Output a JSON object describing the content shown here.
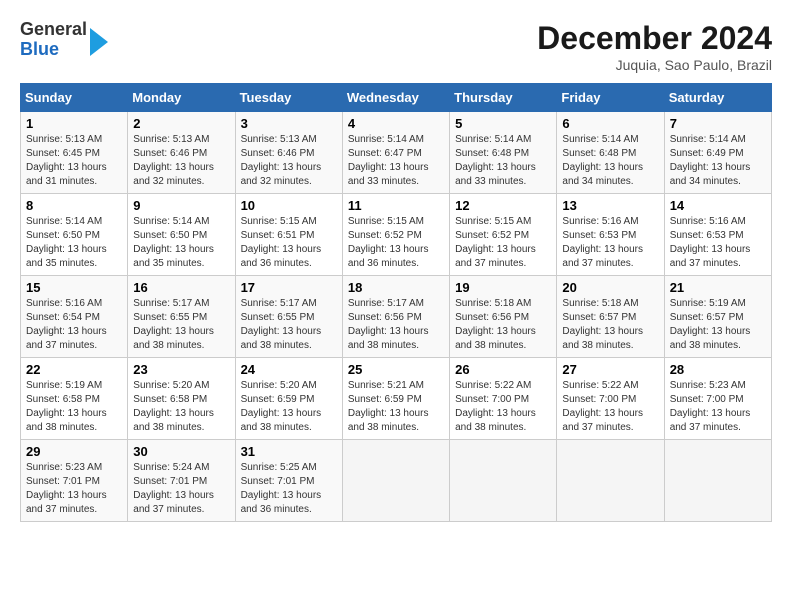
{
  "logo": {
    "general": "General",
    "blue": "Blue"
  },
  "title": "December 2024",
  "subtitle": "Juquia, Sao Paulo, Brazil",
  "weekdays": [
    "Sunday",
    "Monday",
    "Tuesday",
    "Wednesday",
    "Thursday",
    "Friday",
    "Saturday"
  ],
  "weeks": [
    [
      {
        "day": "1",
        "sunrise": "5:13 AM",
        "sunset": "6:45 PM",
        "daylight": "13 hours and 31 minutes."
      },
      {
        "day": "2",
        "sunrise": "5:13 AM",
        "sunset": "6:46 PM",
        "daylight": "13 hours and 32 minutes."
      },
      {
        "day": "3",
        "sunrise": "5:13 AM",
        "sunset": "6:46 PM",
        "daylight": "13 hours and 32 minutes."
      },
      {
        "day": "4",
        "sunrise": "5:14 AM",
        "sunset": "6:47 PM",
        "daylight": "13 hours and 33 minutes."
      },
      {
        "day": "5",
        "sunrise": "5:14 AM",
        "sunset": "6:48 PM",
        "daylight": "13 hours and 33 minutes."
      },
      {
        "day": "6",
        "sunrise": "5:14 AM",
        "sunset": "6:48 PM",
        "daylight": "13 hours and 34 minutes."
      },
      {
        "day": "7",
        "sunrise": "5:14 AM",
        "sunset": "6:49 PM",
        "daylight": "13 hours and 34 minutes."
      }
    ],
    [
      {
        "day": "8",
        "sunrise": "5:14 AM",
        "sunset": "6:50 PM",
        "daylight": "13 hours and 35 minutes."
      },
      {
        "day": "9",
        "sunrise": "5:14 AM",
        "sunset": "6:50 PM",
        "daylight": "13 hours and 35 minutes."
      },
      {
        "day": "10",
        "sunrise": "5:15 AM",
        "sunset": "6:51 PM",
        "daylight": "13 hours and 36 minutes."
      },
      {
        "day": "11",
        "sunrise": "5:15 AM",
        "sunset": "6:52 PM",
        "daylight": "13 hours and 36 minutes."
      },
      {
        "day": "12",
        "sunrise": "5:15 AM",
        "sunset": "6:52 PM",
        "daylight": "13 hours and 37 minutes."
      },
      {
        "day": "13",
        "sunrise": "5:16 AM",
        "sunset": "6:53 PM",
        "daylight": "13 hours and 37 minutes."
      },
      {
        "day": "14",
        "sunrise": "5:16 AM",
        "sunset": "6:53 PM",
        "daylight": "13 hours and 37 minutes."
      }
    ],
    [
      {
        "day": "15",
        "sunrise": "5:16 AM",
        "sunset": "6:54 PM",
        "daylight": "13 hours and 37 minutes."
      },
      {
        "day": "16",
        "sunrise": "5:17 AM",
        "sunset": "6:55 PM",
        "daylight": "13 hours and 38 minutes."
      },
      {
        "day": "17",
        "sunrise": "5:17 AM",
        "sunset": "6:55 PM",
        "daylight": "13 hours and 38 minutes."
      },
      {
        "day": "18",
        "sunrise": "5:17 AM",
        "sunset": "6:56 PM",
        "daylight": "13 hours and 38 minutes."
      },
      {
        "day": "19",
        "sunrise": "5:18 AM",
        "sunset": "6:56 PM",
        "daylight": "13 hours and 38 minutes."
      },
      {
        "day": "20",
        "sunrise": "5:18 AM",
        "sunset": "6:57 PM",
        "daylight": "13 hours and 38 minutes."
      },
      {
        "day": "21",
        "sunrise": "5:19 AM",
        "sunset": "6:57 PM",
        "daylight": "13 hours and 38 minutes."
      }
    ],
    [
      {
        "day": "22",
        "sunrise": "5:19 AM",
        "sunset": "6:58 PM",
        "daylight": "13 hours and 38 minutes."
      },
      {
        "day": "23",
        "sunrise": "5:20 AM",
        "sunset": "6:58 PM",
        "daylight": "13 hours and 38 minutes."
      },
      {
        "day": "24",
        "sunrise": "5:20 AM",
        "sunset": "6:59 PM",
        "daylight": "13 hours and 38 minutes."
      },
      {
        "day": "25",
        "sunrise": "5:21 AM",
        "sunset": "6:59 PM",
        "daylight": "13 hours and 38 minutes."
      },
      {
        "day": "26",
        "sunrise": "5:22 AM",
        "sunset": "7:00 PM",
        "daylight": "13 hours and 38 minutes."
      },
      {
        "day": "27",
        "sunrise": "5:22 AM",
        "sunset": "7:00 PM",
        "daylight": "13 hours and 37 minutes."
      },
      {
        "day": "28",
        "sunrise": "5:23 AM",
        "sunset": "7:00 PM",
        "daylight": "13 hours and 37 minutes."
      }
    ],
    [
      {
        "day": "29",
        "sunrise": "5:23 AM",
        "sunset": "7:01 PM",
        "daylight": "13 hours and 37 minutes."
      },
      {
        "day": "30",
        "sunrise": "5:24 AM",
        "sunset": "7:01 PM",
        "daylight": "13 hours and 37 minutes."
      },
      {
        "day": "31",
        "sunrise": "5:25 AM",
        "sunset": "7:01 PM",
        "daylight": "13 hours and 36 minutes."
      },
      null,
      null,
      null,
      null
    ]
  ]
}
